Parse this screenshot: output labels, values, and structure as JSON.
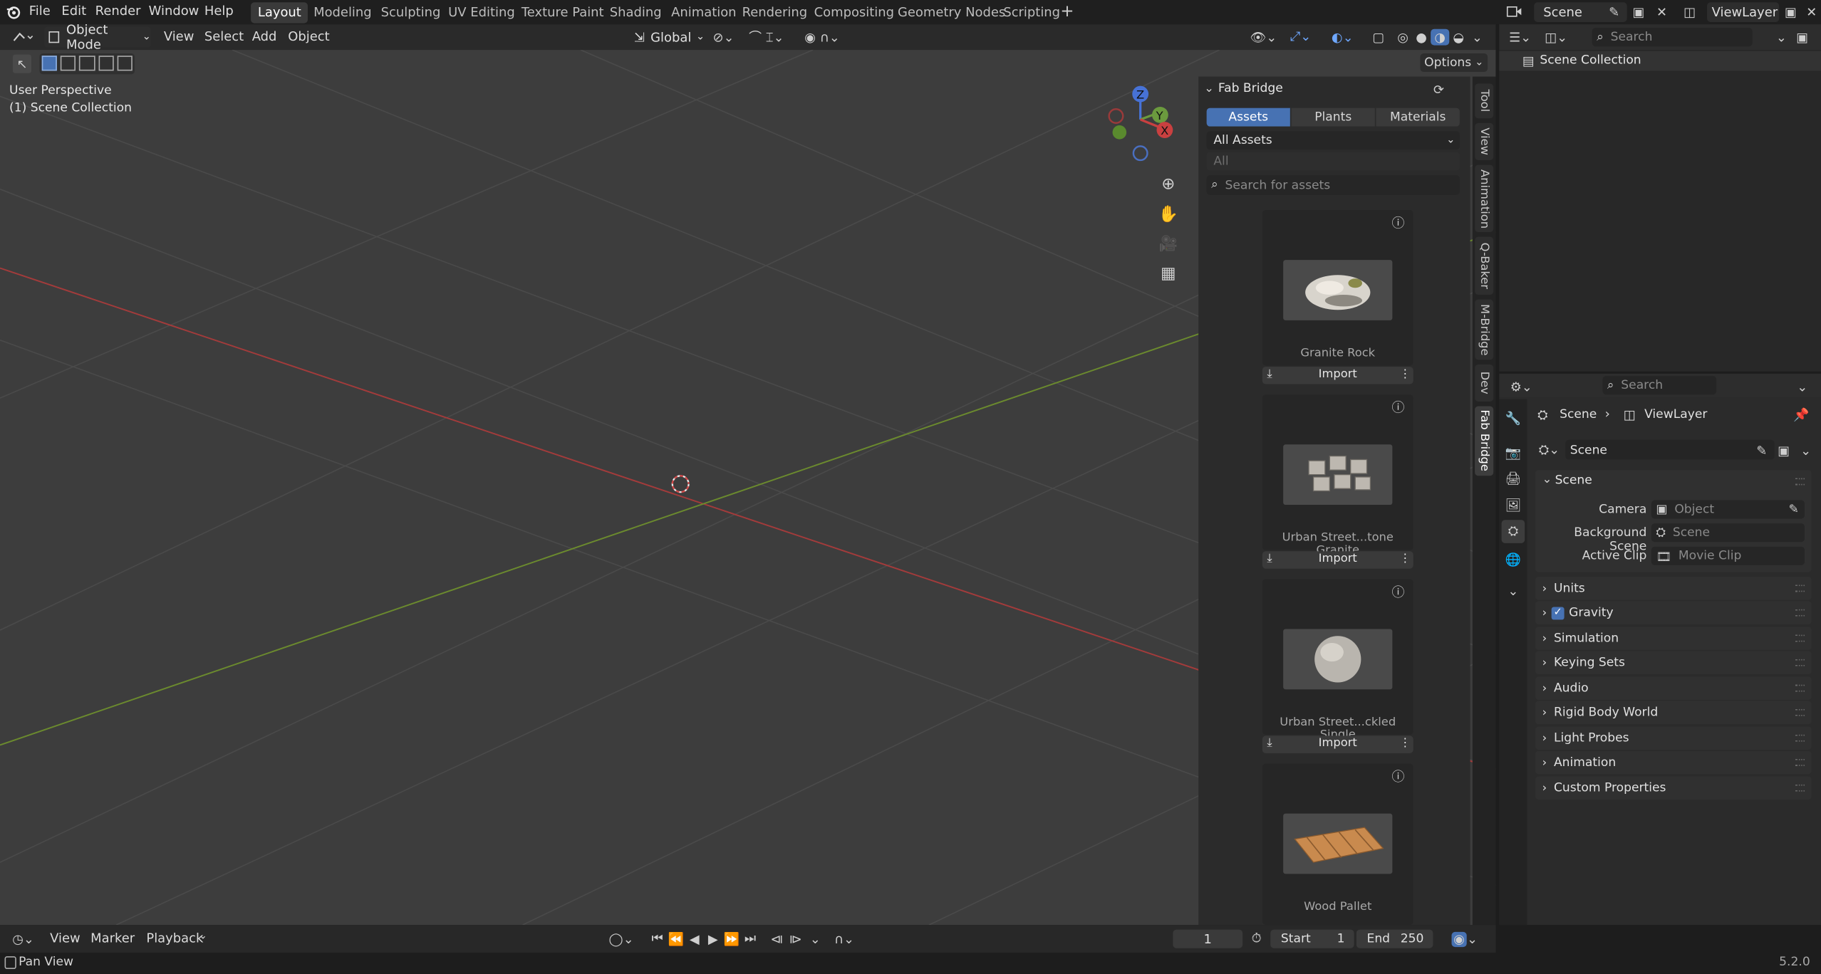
{
  "topbar": {
    "menus": [
      "File",
      "Edit",
      "Render",
      "Window",
      "Help"
    ],
    "workspaces": [
      "Layout",
      "Modeling",
      "Sculpting",
      "UV Editing",
      "Texture Paint",
      "Shading",
      "Animation",
      "Rendering",
      "Compositing",
      "Geometry Nodes",
      "Scripting"
    ],
    "active_workspace": "Layout",
    "scene_name": "Scene",
    "view_layer": "ViewLayer"
  },
  "viewport_header": {
    "mode": "Object Mode",
    "menus": [
      "View",
      "Select",
      "Add",
      "Object"
    ],
    "orientation": "Global",
    "options": "Options"
  },
  "viewport": {
    "perspective_label": "User Perspective",
    "collection_label": "(1) Scene Collection"
  },
  "fab_bridge": {
    "title": "Fab Bridge",
    "tabs": [
      "Assets",
      "Plants",
      "Materials"
    ],
    "active_tab": "Assets",
    "filter": "All Assets",
    "subfilter": "All",
    "search_placeholder": "Search for assets",
    "import_label": "Import",
    "assets": [
      {
        "name": "Granite Rock"
      },
      {
        "name": "Urban Street...tone Granite"
      },
      {
        "name": "Urban Street...ckled Single"
      },
      {
        "name": "Wood Pallet"
      }
    ]
  },
  "side_tabs": [
    "Tool",
    "View",
    "Animation",
    "Q-Baker",
    "M-Bridge",
    "Dev",
    "Fab Bridge"
  ],
  "outliner": {
    "search_placeholder": "Search",
    "root": "Scene Collection"
  },
  "properties": {
    "search_placeholder": "Search",
    "breadcrumb_scene": "Scene",
    "breadcrumb_layer": "ViewLayer",
    "datablock": "Scene",
    "scene_panel": "Scene",
    "camera_label": "Camera",
    "camera_value": "Object",
    "background_label": "Background Scene",
    "background_value": "Scene",
    "clip_label": "Active Clip",
    "clip_value": "Movie Clip",
    "panels": [
      "Units",
      "Gravity",
      "Simulation",
      "Keying Sets",
      "Audio",
      "Rigid Body World",
      "Light Probes",
      "Animation",
      "Custom Properties"
    ]
  },
  "timeline": {
    "menus": [
      "View",
      "Marker",
      "Playback"
    ],
    "current_frame": "1",
    "start_label": "Start",
    "start_value": "1",
    "end_label": "End",
    "end_value": "250"
  },
  "status": {
    "hint": "Pan View",
    "version": "5.2.0"
  }
}
